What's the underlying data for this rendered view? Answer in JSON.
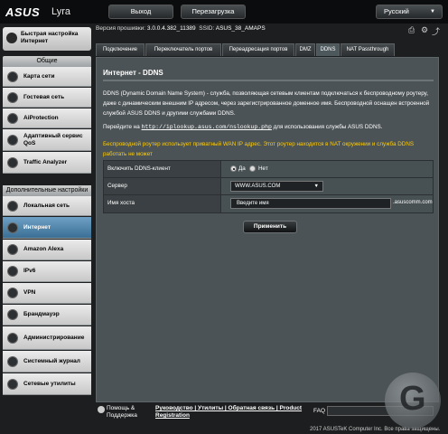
{
  "header": {
    "logo": "ASUS",
    "model": "Lyra",
    "logout_label": "Выход",
    "reboot_label": "Перезагрузка",
    "language": "Русский"
  },
  "firmware": {
    "label": "Версия прошивки:",
    "version": "3.0.0.4.382_11389",
    "ssid_label": "SSID:",
    "ssid": "ASUS_38_AMAPS"
  },
  "sidebar": {
    "quick_setup": "Быстрая настройка Интернет",
    "general_title": "Общие",
    "general_items": [
      {
        "label": "Карта сети",
        "icon": "network-map-icon"
      },
      {
        "label": "Гостевая сеть",
        "icon": "guest-network-icon"
      },
      {
        "label": "AiProtection",
        "icon": "shield-icon"
      },
      {
        "label": "Адаптивный сервис QoS",
        "icon": "qos-icon"
      },
      {
        "label": "Traffic Analyzer",
        "icon": "traffic-icon"
      }
    ],
    "advanced_title": "Дополнительные настройки",
    "advanced_items": [
      {
        "label": "Локальная сеть",
        "icon": "lan-icon"
      },
      {
        "label": "Интернет",
        "icon": "globe-icon"
      },
      {
        "label": "Amazon Alexa",
        "icon": "alexa-icon"
      },
      {
        "label": "IPv6",
        "icon": "ipv6-icon"
      },
      {
        "label": "VPN",
        "icon": "vpn-icon"
      },
      {
        "label": "Брандмауэр",
        "icon": "firewall-icon"
      },
      {
        "label": "Админист­рирование",
        "icon": "admin-icon"
      },
      {
        "label": "Системный журнал",
        "icon": "log-icon"
      },
      {
        "label": "Сетевые утилиты",
        "icon": "tools-icon"
      }
    ]
  },
  "tabs": [
    "Подключение",
    "Переключатель портов",
    "Переадресация портов",
    "DMZ",
    "DDNS",
    "NAT Passthrough"
  ],
  "main": {
    "title": "Интернет - DDNS",
    "description": "DDNS (Dynamic Domain Name System) - служба, позволяющая сетевым клиентам подключаться к беспроводному роутеру, даже с динамическим внешним IP адресом, через зарегистрированное доменное имя. Беспроводной оснащен встроенной службой ASUS DDNS и другими службами DDNS.",
    "goto_prefix": "Перейдите на",
    "goto_link": "http://iplookup.asus.com/nslookup.php",
    "goto_suffix": "для использования службы ASUS DDNS.",
    "warning": "Беспроводной роутер использует приватный WAN IP адрес. Этот роутер находится в NAT окружении и служба DDNS работать не может",
    "enable_label": "Включить DDNS-клиент",
    "yes_label": "Да",
    "no_label": "Нет",
    "enabled": true,
    "server_label": "Сервер",
    "server_value": "WWW.ASUS.COM",
    "host_label": "Имя хоста",
    "host_placeholder": "Введите имя",
    "host_suffix": ".asuscomm.com",
    "apply_label": "Применить"
  },
  "footer": {
    "help_line1": "Помощь &",
    "help_line2": "Поддержка",
    "links_line1": "Руководство | Утилиты | Обратная связь | Product",
    "links_line2": "Registration",
    "faq": "FAQ",
    "copyright": "2017 ASUSTeK Computer Inc. Все права защищены."
  }
}
